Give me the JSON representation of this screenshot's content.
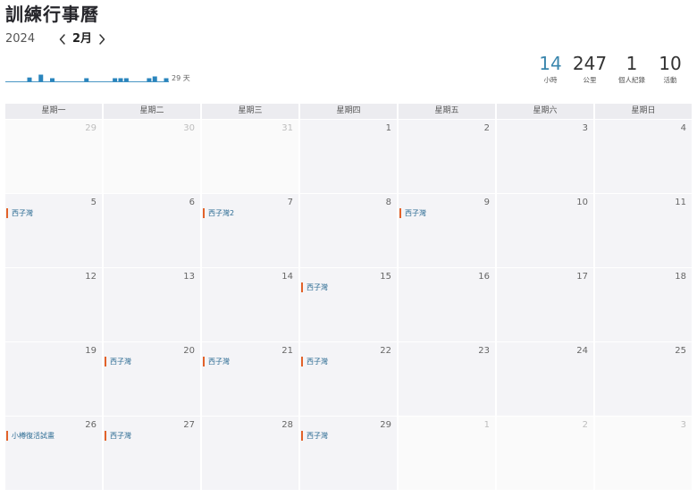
{
  "app": {
    "title": "訓練行事曆"
  },
  "nav": {
    "year": "2024",
    "month": "2月",
    "prev_icon": "chevron-left-icon",
    "next_icon": "chevron-right-icon"
  },
  "activity_chart": {
    "type": "bar",
    "x_range": [
      1,
      29
    ],
    "days_label": "29 天",
    "bars": [
      {
        "day": 5,
        "level": 0.6
      },
      {
        "day": 7,
        "level": 1.0
      },
      {
        "day": 9,
        "level": 0.5
      },
      {
        "day": 15,
        "level": 0.5
      },
      {
        "day": 20,
        "level": 0.5
      },
      {
        "day": 21,
        "level": 0.5
      },
      {
        "day": 22,
        "level": 0.5
      },
      {
        "day": 26,
        "level": 0.5
      },
      {
        "day": 27,
        "level": 0.75
      },
      {
        "day": 29,
        "level": 0.5
      }
    ]
  },
  "stats": [
    {
      "value": "14",
      "label": "小時"
    },
    {
      "value": "247",
      "label": "公里"
    },
    {
      "value": "1",
      "label": "個人紀錄"
    },
    {
      "value": "10",
      "label": "活動"
    }
  ],
  "calendar": {
    "weekdays": [
      "星期一",
      "星期二",
      "星期三",
      "星期四",
      "星期五",
      "星期六",
      "星期日"
    ],
    "weeks": [
      [
        {
          "day": "29",
          "other_month": true
        },
        {
          "day": "30",
          "other_month": true
        },
        {
          "day": "31",
          "other_month": true
        },
        {
          "day": "1"
        },
        {
          "day": "2"
        },
        {
          "day": "3"
        },
        {
          "day": "4"
        }
      ],
      [
        {
          "day": "5",
          "activities": [
            {
              "name": "西子灣"
            }
          ]
        },
        {
          "day": "6"
        },
        {
          "day": "7",
          "activities": [
            {
              "name": "西子灣2"
            }
          ]
        },
        {
          "day": "8"
        },
        {
          "day": "9",
          "activities": [
            {
              "name": "西子灣"
            }
          ]
        },
        {
          "day": "10"
        },
        {
          "day": "11"
        }
      ],
      [
        {
          "day": "12"
        },
        {
          "day": "13"
        },
        {
          "day": "14"
        },
        {
          "day": "15",
          "activities": [
            {
              "name": "西子灣"
            }
          ]
        },
        {
          "day": "16"
        },
        {
          "day": "17"
        },
        {
          "day": "18"
        }
      ],
      [
        {
          "day": "19"
        },
        {
          "day": "20",
          "activities": [
            {
              "name": "西子灣"
            }
          ]
        },
        {
          "day": "21",
          "activities": [
            {
              "name": "西子灣"
            }
          ]
        },
        {
          "day": "22",
          "activities": [
            {
              "name": "西子灣"
            }
          ]
        },
        {
          "day": "23"
        },
        {
          "day": "24"
        },
        {
          "day": "25"
        }
      ],
      [
        {
          "day": "26",
          "activities": [
            {
              "name": "小樽復活試畫"
            }
          ]
        },
        {
          "day": "27",
          "activities": [
            {
              "name": "西子灣"
            }
          ]
        },
        {
          "day": "28"
        },
        {
          "day": "29",
          "activities": [
            {
              "name": "西子灣"
            }
          ]
        },
        {
          "day": "1",
          "other_month": true
        },
        {
          "day": "2",
          "other_month": true
        },
        {
          "day": "3",
          "other_month": true
        }
      ]
    ]
  },
  "colors": {
    "title": "#26262b",
    "highlight_stat": "#3a86ad",
    "chart_bar": "#2a85bd",
    "chart_baseline": "#4b97c4",
    "activity_marker": "#e2622a",
    "activity_text": "#2c6b93",
    "cell_current": "#f4f4f7",
    "cell_other": "#fafafa",
    "weekday_header_bg": "#ececf0"
  }
}
